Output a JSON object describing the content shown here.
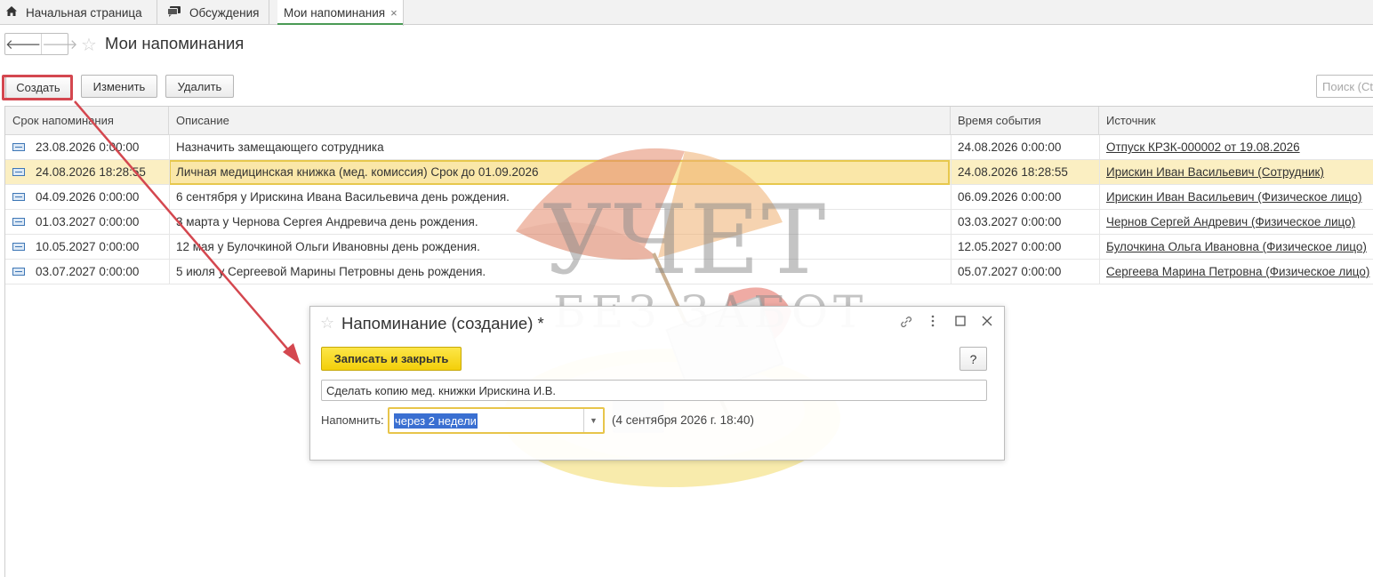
{
  "tabs": [
    {
      "label": "Начальная страница",
      "icon": "home-icon"
    },
    {
      "label": "Обсуждения",
      "icon": "discussions-icon"
    },
    {
      "label": "Мои напоминания",
      "close": "×"
    }
  ],
  "page": {
    "title": "Мои напоминания"
  },
  "toolbar": {
    "create": "Создать",
    "edit": "Изменить",
    "delete": "Удалить",
    "search_placeholder": "Поиск (Ct"
  },
  "table": {
    "columns": [
      "Срок напоминания",
      "Описание",
      "Время события",
      "Источник"
    ],
    "rows": [
      {
        "due": "23.08.2026 0:00:00",
        "desc": "Назначить замещающего сотрудника",
        "event": "24.08.2026 0:00:00",
        "source": "Отпуск КРЗК-000002 от 19.08.2026",
        "selected": false
      },
      {
        "due": "24.08.2026 18:28:55",
        "desc": "Личная медицинская книжка (мед. комиссия) Срок до 01.09.2026",
        "event": "24.08.2026 18:28:55",
        "source": "Ирискин Иван Васильевич (Сотрудник)",
        "selected": true
      },
      {
        "due": "04.09.2026 0:00:00",
        "desc": "6 сентября у Ирискина Ивана Васильевича день рождения.",
        "event": "06.09.2026 0:00:00",
        "source": "Ирискин Иван Васильевич (Физическое лицо)",
        "selected": false
      },
      {
        "due": "01.03.2027 0:00:00",
        "desc": "3 марта у Чернова Сергея Андревича день рождения.",
        "event": "03.03.2027 0:00:00",
        "source": "Чернов Сергей Андревич (Физическое лицо)",
        "selected": false
      },
      {
        "due": "10.05.2027 0:00:00",
        "desc": "12 мая у Булочкиной Ольги Ивановны день рождения.",
        "event": "12.05.2027 0:00:00",
        "source": "Булочкина Ольга Ивановна (Физическое лицо)",
        "selected": false
      },
      {
        "due": "03.07.2027 0:00:00",
        "desc": "5 июля у Сергеевой Марины Петровны день рождения.",
        "event": "05.07.2027 0:00:00",
        "source": "Сергеева Марина Петровна (Физическое лицо)",
        "selected": false
      }
    ]
  },
  "watermark": {
    "line1": "УЧЕТ",
    "line2": "БЕЗ ЗАБОТ"
  },
  "dialog": {
    "title": "Напоминание (создание) *",
    "save_button": "Записать и закрыть",
    "help": "?",
    "description": "Сделать копию мед. книжки Ирискина И.В.",
    "remind_label": "Напомнить:",
    "remind_value": "через 2 недели",
    "remind_date": "(4 сентября 2026 г. 18:40)"
  },
  "colors": {
    "accent_yellow": "#f3cf0a",
    "selection_row": "#fbefc2",
    "annotation_red": "#d4474f",
    "active_tab_underline": "#4a9a55"
  }
}
